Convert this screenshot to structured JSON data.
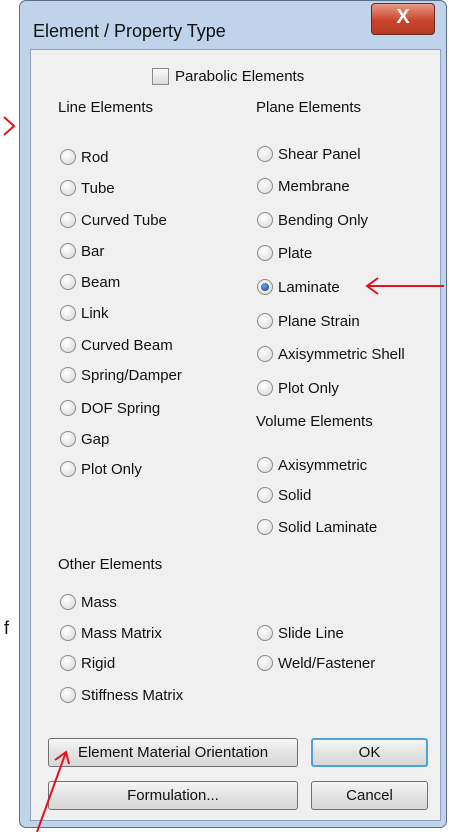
{
  "window": {
    "title": "Element / Property Type",
    "close_glyph": "X"
  },
  "parabolic": {
    "label": "Parabolic Elements",
    "checked": false
  },
  "line_elements": {
    "heading": "Line Elements",
    "items": [
      {
        "label": "Rod",
        "selected": false
      },
      {
        "label": "Tube",
        "selected": false
      },
      {
        "label": "Curved Tube",
        "selected": false
      },
      {
        "label": "Bar",
        "selected": false
      },
      {
        "label": "Beam",
        "selected": false
      },
      {
        "label": "Link",
        "selected": false
      },
      {
        "label": "Curved Beam",
        "selected": false
      },
      {
        "label": "Spring/Damper",
        "selected": false
      },
      {
        "label": "DOF Spring",
        "selected": false
      },
      {
        "label": "Gap",
        "selected": false
      },
      {
        "label": "Plot Only",
        "selected": false
      }
    ]
  },
  "plane_elements": {
    "heading": "Plane Elements",
    "items": [
      {
        "label": "Shear Panel",
        "selected": false
      },
      {
        "label": "Membrane",
        "selected": false
      },
      {
        "label": "Bending Only",
        "selected": false
      },
      {
        "label": "Plate",
        "selected": false
      },
      {
        "label": "Laminate",
        "selected": true
      },
      {
        "label": "Plane Strain",
        "selected": false
      },
      {
        "label": "Axisymmetric Shell",
        "selected": false
      },
      {
        "label": "Plot Only",
        "selected": false
      }
    ]
  },
  "volume_elements": {
    "heading": "Volume Elements",
    "items": [
      {
        "label": "Axisymmetric",
        "selected": false
      },
      {
        "label": "Solid",
        "selected": false
      },
      {
        "label": "Solid Laminate",
        "selected": false
      }
    ]
  },
  "other_elements": {
    "heading": "Other Elements",
    "items": [
      {
        "label": "Mass",
        "selected": false
      },
      {
        "label": "Mass Matrix",
        "selected": false
      },
      {
        "label": "Slide Line",
        "selected": false
      },
      {
        "label": "Rigid",
        "selected": false
      },
      {
        "label": "Weld/Fastener",
        "selected": false
      },
      {
        "label": "Stiffness Matrix",
        "selected": false
      }
    ]
  },
  "buttons": {
    "orientation": "Element Material Orientation",
    "ok": "OK",
    "formulation": "Formulation...",
    "cancel": "Cancel"
  },
  "annotations": {
    "stray_char": "f",
    "arrow_color": "#e0141e"
  },
  "colors": {
    "frame": "#bfd3ea",
    "client": "#f0f0f0",
    "close": "#c9452c",
    "default_focus": "#4aa3df"
  }
}
